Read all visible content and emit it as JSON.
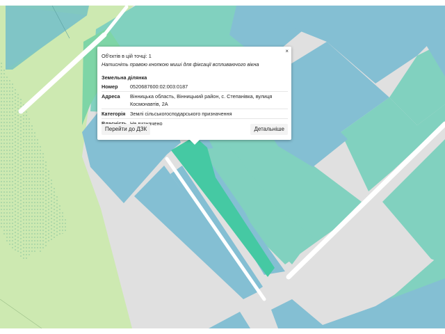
{
  "map": {
    "colors": {
      "background": "#e0e0e0",
      "field": "#cde9b1",
      "forest_texture": "#7fbf9a",
      "parcel_blue": "#84bfd3",
      "parcel_teal": "#81d1bf",
      "parcel_selected": "#45c9a3",
      "road": "#ffffff"
    }
  },
  "popup": {
    "close_label": "×",
    "count": "Об'єктів в цій точці: 1",
    "hint": "Натисніть правою кнопкою миші для фіксації вспливаючого вікна",
    "section_title": "Земельна ділянка",
    "rows": [
      {
        "key": "Номер",
        "value": "0520687600:02:003:0187"
      },
      {
        "key": "Адреса",
        "value": "Вінницька область, Вінницький район, с. Степанівка, вулиця Космонавтів, 2А"
      },
      {
        "key": "Категорія",
        "value": "Землі сільськогосподарського призначення"
      },
      {
        "key": "Власність",
        "value": "Не визначено"
      }
    ],
    "btn_dzk": "Перейти до ДЗК",
    "btn_details": "Детальніше"
  }
}
